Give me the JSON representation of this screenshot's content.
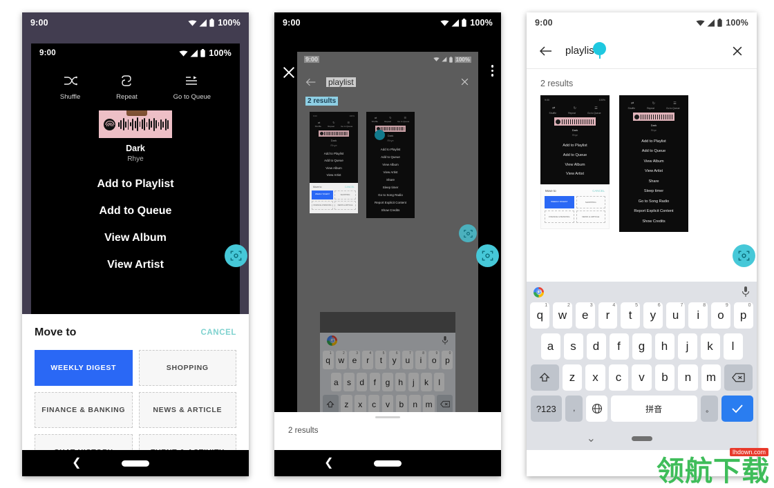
{
  "meta": {
    "watermark_text": "领航下载",
    "watermark_badge": "lhdown.com"
  },
  "status_bar": {
    "time": "9:00",
    "battery": "100%",
    "wifi_icon": "wifi-icon",
    "signal_icon": "signal-icon",
    "battery_icon": "battery-icon"
  },
  "phone1": {
    "outer_status_time": "9:00",
    "outer_status_battery": "100%",
    "inner_status_time": "9:00",
    "inner_status_battery": "100%",
    "player_actions": [
      {
        "icon": "shuffle-icon",
        "label": "Shuffle"
      },
      {
        "icon": "repeat-icon",
        "label": "Repeat"
      },
      {
        "icon": "queue-icon",
        "label": "Go to Queue"
      }
    ],
    "now_playing": {
      "title": "Dark",
      "artist": "Rhye",
      "art_icon": "spotify-code-art"
    },
    "menu_items": [
      "Add to Playlist",
      "Add to Queue",
      "View Album",
      "View Artist"
    ],
    "sheet": {
      "title": "Move to",
      "cancel_label": "CANCEL",
      "selected_chip": "WEEKLY DIGEST",
      "accent_color": "#2a68f5",
      "cancel_color": "#7fd2cf",
      "chips": [
        "WEEKLY DIGEST",
        "SHOPPING",
        "FINANCE & BANKING",
        "NEWS & ARTICLE",
        "CHAT HISTORY",
        "EVENT & ACTIVITY"
      ]
    },
    "nav": {
      "back_icon": "back-chevron-icon",
      "home_icon": "home-pill-icon"
    },
    "fab": {
      "icon": "scan-focus-icon",
      "color": "#46c8d8"
    }
  },
  "phone2": {
    "status_time": "9:00",
    "status_battery": "100%",
    "close_icon": "close-icon",
    "overflow_icon": "more-vertical-icon",
    "inner": {
      "status_time": "9:00",
      "status_battery": "100%",
      "back_icon": "back-arrow-icon",
      "query": "playlist",
      "clear_icon": "close-icon",
      "results_label": "2 results"
    },
    "bottom_sheet": {
      "results_label": "2 results"
    },
    "fab": {
      "icon": "scan-focus-icon",
      "color": "#46c8d8"
    },
    "inner_fab": {
      "icon": "scan-focus-icon"
    },
    "nav": {
      "back_icon": "back-chevron-icon",
      "home_icon": "home-pill-icon"
    }
  },
  "phone3": {
    "status_time": "9:00",
    "status_battery": "100%",
    "back_icon": "back-arrow-icon",
    "query": "playlist",
    "clear_icon": "close-icon",
    "results_label": "2 results",
    "fab": {
      "icon": "scan-focus-icon",
      "color": "#46c8d8"
    },
    "nav": {
      "back_icon": "back-chevron-icon",
      "home_icon": "home-pill-icon"
    }
  },
  "result_cards": {
    "card_a": {
      "menu_items": [
        "Add to Playlist",
        "Add to Queue",
        "View Album",
        "View Artist"
      ],
      "actions": [
        "Shuffle",
        "Repeat",
        "Go to Queue"
      ],
      "title": "Dark",
      "artist": "Rhye",
      "sheet_title": "Move to",
      "sheet_cancel": "CANCEL",
      "chips": [
        "WEEKLY DIGEST",
        "SHOPPING",
        "FINANCE & BANKING",
        "NEWS & ARTICLE"
      ]
    },
    "card_b": {
      "actions": [
        "Shuffle",
        "Repeat",
        "Go to Queue"
      ],
      "title": "Dark",
      "artist": "Rhye",
      "menu_items": [
        "Add to Playlist",
        "Add to Queue",
        "View Album",
        "View Artist",
        "Share",
        "Sleep timer",
        "Go to Song Radio",
        "Report Explicit Content",
        "Show Credits"
      ]
    }
  },
  "keyboard": {
    "google_icon": "google-logo-icon",
    "mic_icon": "microphone-icon",
    "row1": [
      {
        "key": "q",
        "num": "1"
      },
      {
        "key": "w",
        "num": "2"
      },
      {
        "key": "e",
        "num": "3"
      },
      {
        "key": "r",
        "num": "4"
      },
      {
        "key": "t",
        "num": "5"
      },
      {
        "key": "y",
        "num": "6"
      },
      {
        "key": "u",
        "num": "7"
      },
      {
        "key": "i",
        "num": "8"
      },
      {
        "key": "o",
        "num": "9"
      },
      {
        "key": "p",
        "num": "0"
      }
    ],
    "row2": [
      "a",
      "s",
      "d",
      "f",
      "g",
      "h",
      "j",
      "k",
      "l"
    ],
    "row3": [
      "z",
      "x",
      "c",
      "v",
      "b",
      "n",
      "m"
    ],
    "shift_icon": "shift-icon",
    "backspace_icon": "backspace-icon",
    "symbols_key": "?123",
    "emoji_key": ",",
    "globe_icon": "globe-icon",
    "space_key": "拼音",
    "period_key": "。",
    "enter_icon": "check-icon",
    "collapse_icon": "chevron-down-icon"
  }
}
